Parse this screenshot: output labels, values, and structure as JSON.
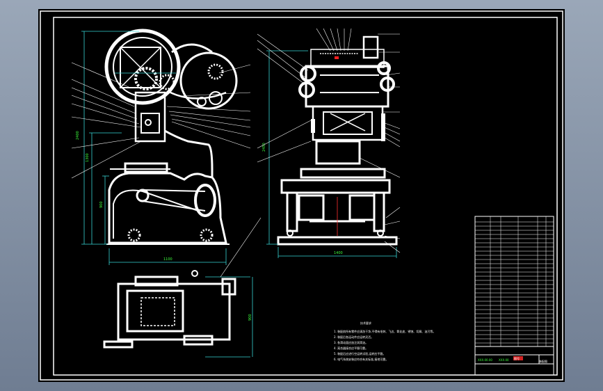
{
  "drawing": {
    "notes_title": "技术要求",
    "notes": [
      "1. 装配前所有零件应清洗干净,不得有毛刺、飞边、氧化皮、锈蚀、切屑、油污等。",
      "2. 装配后各运动件应运转灵活。",
      "3. 各滑动面应加注润滑油。",
      "4. 离合器接合应平稳可靠。",
      "5. 装配后应进行空运转试验,运转应平稳。",
      "6. 电气系统安装应符合有关标准,接地可靠。"
    ],
    "dim_front_height": "2400",
    "dim_front_lower": "1300",
    "dim_front_mid": "900",
    "dim_front_width": "1100",
    "dim_side_height": "2450",
    "dim_side_width": "1400",
    "dim_plan_depth": "900"
  },
  "title_block": {
    "left_label": "XXX.00.00",
    "mid_label": "XXX.00",
    "stamp": "装配图",
    "red_stamp": "图号"
  },
  "colors": {
    "background": "#000000",
    "lines": "#ffffff",
    "dimensions": "#36d4d4",
    "text_green": "#3cff3c"
  }
}
